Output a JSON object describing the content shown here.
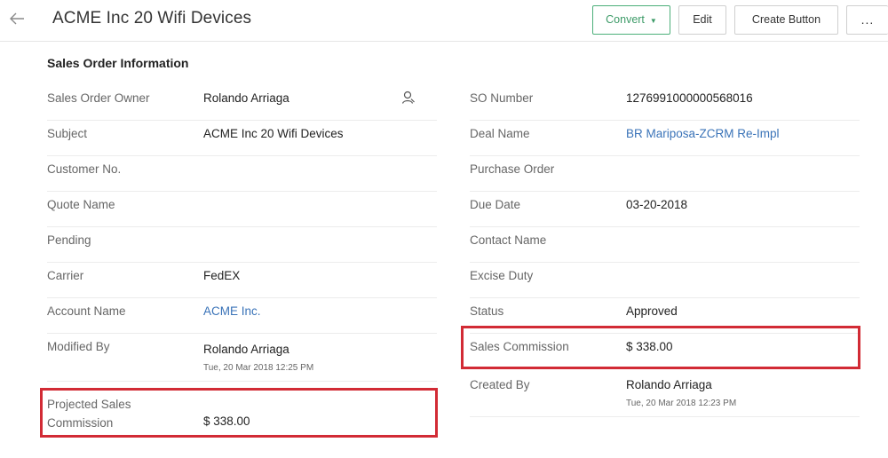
{
  "header": {
    "title": "ACME Inc 20 Wifi Devices",
    "buttons": {
      "convert": "Convert",
      "edit": "Edit",
      "create": "Create Button",
      "more": "..."
    }
  },
  "section": {
    "title": "Sales Order Information"
  },
  "left_fields": [
    {
      "label": "Sales Order Owner",
      "value": "Rolando Arriaga"
    },
    {
      "label": "Subject",
      "value": "ACME Inc 20 Wifi Devices"
    },
    {
      "label": "Customer No.",
      "value": ""
    },
    {
      "label": "Quote Name",
      "value": ""
    },
    {
      "label": "Pending",
      "value": ""
    },
    {
      "label": "Carrier",
      "value": "FedEX"
    },
    {
      "label": "Account Name",
      "value": "ACME Inc."
    },
    {
      "label": "Modified By",
      "value": "Rolando Arriaga",
      "sub": "Tue, 20 Mar 2018 12:25 PM"
    },
    {
      "label_line1": "Projected Sales",
      "label_line2": "Commission",
      "value": "$ 338.00"
    }
  ],
  "right_fields": [
    {
      "label": "SO Number",
      "value": "1276991000000568016"
    },
    {
      "label": "Deal Name",
      "value": "BR Mariposa-ZCRM Re-Impl"
    },
    {
      "label": "Purchase Order",
      "value": ""
    },
    {
      "label": "Due Date",
      "value": "03-20-2018"
    },
    {
      "label": "Contact Name",
      "value": ""
    },
    {
      "label": "Excise Duty",
      "value": ""
    },
    {
      "label": "Status",
      "value": "Approved"
    },
    {
      "label": "Sales Commission",
      "value": "$ 338.00"
    },
    {
      "label": "Created By",
      "value": "Rolando Arriaga",
      "sub": "Tue, 20 Mar 2018 12:23 PM"
    }
  ],
  "colors": {
    "highlight": "#d22b35",
    "link": "#3a73b8",
    "convert_accent": "#3d9b68"
  }
}
